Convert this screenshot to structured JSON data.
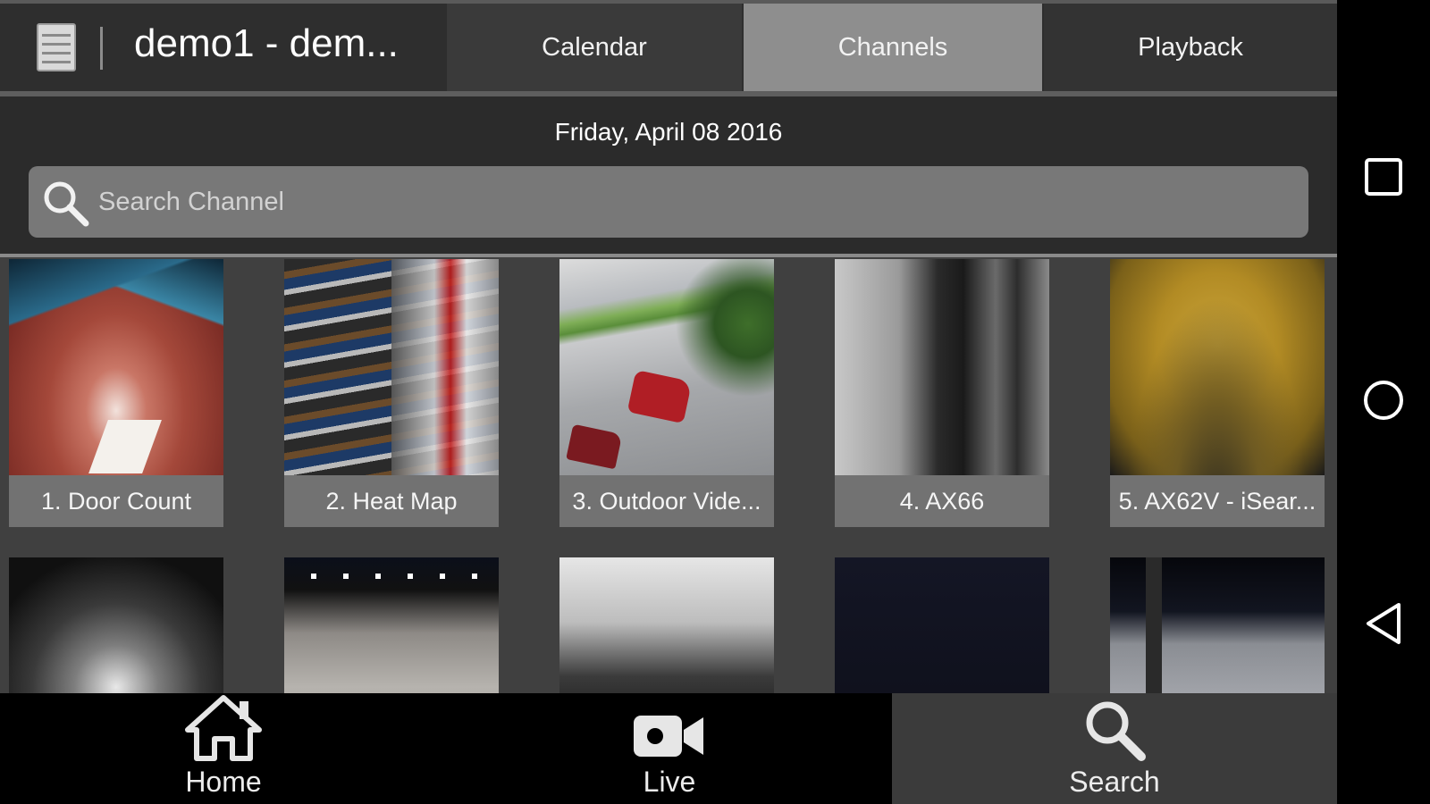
{
  "header": {
    "title": "demo1 - dem...",
    "tabs": [
      {
        "label": "Calendar",
        "active": false
      },
      {
        "label": "Channels",
        "active": true
      },
      {
        "label": "Playback",
        "active": false
      }
    ]
  },
  "date_label": "Friday, April 08 2016",
  "search": {
    "placeholder": "Search Channel",
    "value": ""
  },
  "channels": [
    {
      "name": "1. Door Count"
    },
    {
      "name": "2. Heat Map"
    },
    {
      "name": "3. Outdoor Vide..."
    },
    {
      "name": "4. AX66"
    },
    {
      "name": "5. AX62V - iSear..."
    }
  ],
  "bottom_nav": [
    {
      "label": "Home",
      "icon": "home-icon",
      "active": false
    },
    {
      "label": "Live",
      "icon": "video-camera-icon",
      "active": false
    },
    {
      "label": "Search",
      "icon": "search-icon",
      "active": true
    }
  ],
  "system_bar": {
    "buttons": [
      "recents-icon",
      "home-circle-icon",
      "back-triangle-icon"
    ]
  },
  "colors": {
    "active_tab": "#8e8e8e",
    "search_box": "#787878",
    "label_bar": "#727272",
    "active_nav": "#3b3b3b"
  }
}
